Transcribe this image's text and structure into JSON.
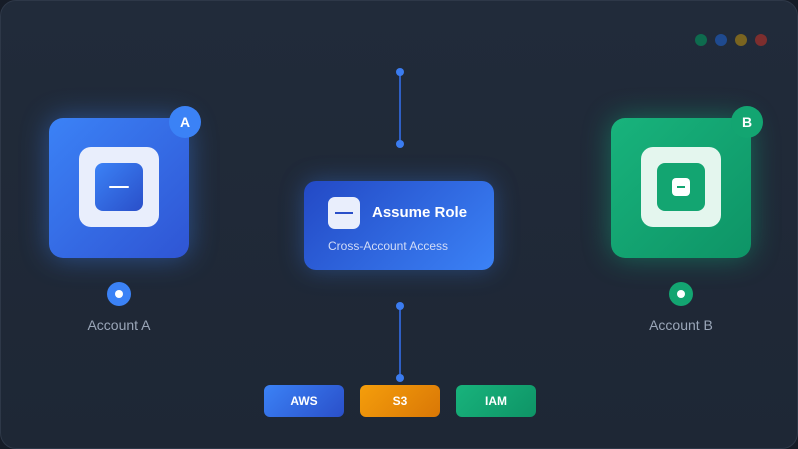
{
  "window": {
    "traffic_dots": [
      {
        "name": "dot-green",
        "color": "#0e6b4e"
      },
      {
        "name": "dot-blue",
        "color": "#1f4a8f"
      },
      {
        "name": "dot-yellow",
        "color": "#7a6420"
      },
      {
        "name": "dot-red",
        "color": "#7d2e2e"
      }
    ]
  },
  "accounts": {
    "a": {
      "badge": "A",
      "label": "Account A",
      "color": "#3b82f6",
      "icon": "minus-icon"
    },
    "b": {
      "badge": "B",
      "label": "Account B",
      "color": "#13a571",
      "icon": "minus-square-icon"
    }
  },
  "role": {
    "title": "Assume Role",
    "subtitle": "Cross-Account Access",
    "icon": "minus-icon"
  },
  "tags": [
    {
      "label": "AWS",
      "color": "#3b82f6"
    },
    {
      "label": "S3",
      "color": "#f59e0b"
    },
    {
      "label": "IAM",
      "color": "#13a571"
    }
  ]
}
